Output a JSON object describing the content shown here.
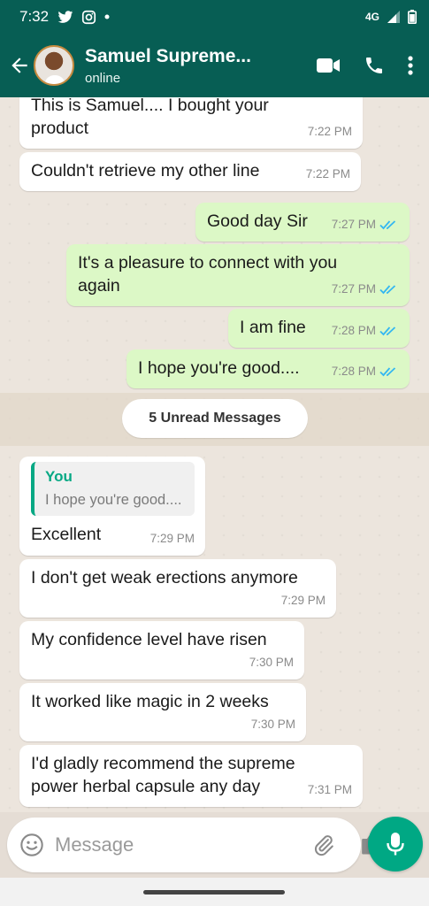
{
  "status_bar": {
    "time": "7:32",
    "network": "4G"
  },
  "header": {
    "contact_name": "Samuel Supreme...",
    "presence": "online"
  },
  "messages": [
    {
      "direction": "in",
      "text": "This is Samuel.... I bought your product",
      "time": "7:22 PM"
    },
    {
      "direction": "in",
      "text": "Couldn't retrieve my other line",
      "time": "7:22 PM"
    },
    {
      "direction": "out",
      "text": "Good day Sir",
      "time": "7:27 PM",
      "status": "read"
    },
    {
      "direction": "out",
      "text": "It's a pleasure to connect with you again",
      "time": "7:27 PM",
      "status": "read"
    },
    {
      "direction": "out",
      "text": "I am fine",
      "time": "7:28 PM",
      "status": "read"
    },
    {
      "direction": "out",
      "text": "I hope you're good....",
      "time": "7:28 PM",
      "status": "read"
    },
    {
      "direction": "in",
      "text": "Excellent",
      "time": "7:29 PM",
      "quote": {
        "author": "You",
        "text": "I hope you're good...."
      }
    },
    {
      "direction": "in",
      "text": "I don't get weak erections anymore",
      "time": "7:29 PM"
    },
    {
      "direction": "in",
      "text": "My confidence level have risen",
      "time": "7:30 PM"
    },
    {
      "direction": "in",
      "text": "It worked like magic in 2 weeks",
      "time": "7:30 PM"
    },
    {
      "direction": "in",
      "text": "I'd gladly recommend the supreme power herbal capsule any day",
      "time": "7:31 PM"
    }
  ],
  "unread_divider": "5 Unread Messages",
  "composer": {
    "placeholder": "Message"
  },
  "icons": {
    "back": "arrow-left-icon",
    "video": "video-call-icon",
    "call": "phone-icon",
    "menu": "more-vertical-icon",
    "emoji": "emoji-icon",
    "attach": "paperclip-icon",
    "camera": "camera-icon",
    "mic": "microphone-icon"
  },
  "colors": {
    "header": "#075e54",
    "outgoing_bubble": "#dcf8c6",
    "incoming_bubble": "#ffffff",
    "accent": "#00a884",
    "read_ticks": "#34b7f1"
  }
}
